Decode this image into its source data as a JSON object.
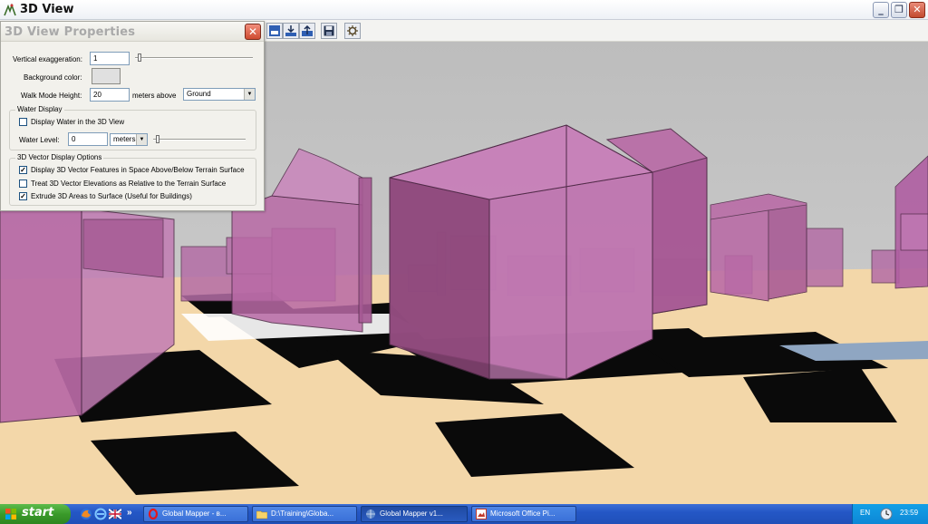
{
  "window": {
    "title": "3D View",
    "buttons": {
      "minimize": "_",
      "restore": "❐",
      "close": "✕"
    }
  },
  "toolbar": {
    "icons": [
      "view-top-icon",
      "view-down-icon",
      "view-up-icon",
      "save-icon",
      "settings-icon"
    ]
  },
  "panel": {
    "title": "3D View Properties",
    "close_label": "✕",
    "vertical_exaggeration": {
      "label": "Vertical exaggeration:",
      "value": "1"
    },
    "background_color": {
      "label": "Background color:",
      "color": "#e0e0e0"
    },
    "walk_mode": {
      "label": "Walk Mode Height:",
      "value": "20",
      "unit_label": "meters above",
      "reference": "Ground"
    },
    "water_display": {
      "group_label": "Water Display",
      "show_water": {
        "label": "Display Water in the 3D View",
        "checked": false
      },
      "water_level": {
        "label": "Water Level:",
        "value": "0",
        "unit": "meters"
      }
    },
    "vector_options": {
      "group_label": "3D Vector Display Options",
      "options": [
        {
          "label": "Display 3D Vector Features in Space Above/Below Terrain Surface",
          "checked": true
        },
        {
          "label": "Treat 3D Vector Elevations as Relative to the Terrain Surface",
          "checked": false
        },
        {
          "label": "Extrude 3D Areas to Surface (Useful for Buildings)",
          "checked": true
        }
      ]
    }
  },
  "taskbar": {
    "start_label": "start",
    "tasks": [
      {
        "label": "Global Mapper - в...",
        "icon": "opera-icon",
        "active": false
      },
      {
        "label": "D:\\Training\\Globa...",
        "icon": "folder-icon",
        "active": false
      },
      {
        "label": "Global Mapper v1...",
        "icon": "globe-icon",
        "active": true
      },
      {
        "label": "Microsoft Office Pi...",
        "icon": "picture-icon",
        "active": false
      }
    ],
    "tray": {
      "language": "EN",
      "time": "23:59"
    }
  },
  "colors": {
    "building_fill": "#b96aa6",
    "building_edge": "#4f2a47",
    "ground": "#f3d7a9",
    "sky": "#c2c2c2"
  }
}
